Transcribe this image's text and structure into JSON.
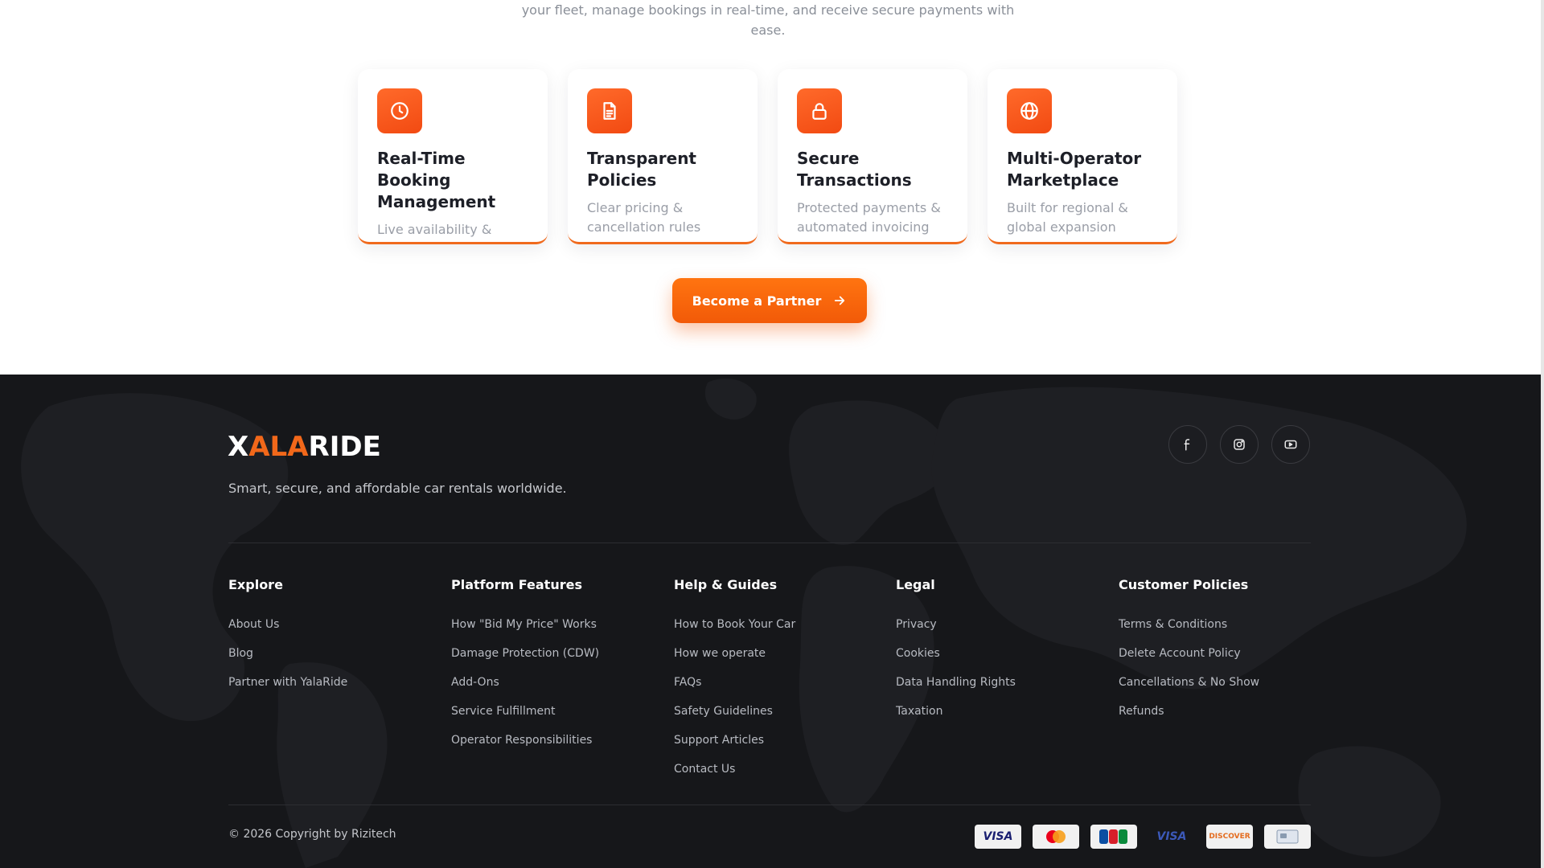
{
  "intro": {
    "line1": "your fleet, manage bookings in real-time, and receive secure payments with",
    "line2": "ease."
  },
  "features": [
    {
      "icon": "clock-icon",
      "title": "Real-Time Booking Management",
      "desc": "Live availability &"
    },
    {
      "icon": "document-icon",
      "title": "Transparent Policies",
      "desc": "Clear pricing & cancellation rules"
    },
    {
      "icon": "lock-icon",
      "title": "Secure Transactions",
      "desc": "Protected payments & automated invoicing"
    },
    {
      "icon": "globe-icon",
      "title": "Multi-Operator Marketplace",
      "desc": "Built for regional & global expansion"
    }
  ],
  "cta": {
    "label": "Become a Partner"
  },
  "footer": {
    "logo": {
      "x": "X",
      "ala": "ALA",
      "ride": "RIDE"
    },
    "tagline": "Smart, secure, and affordable car rentals worldwide.",
    "social": [
      "facebook-icon",
      "instagram-icon",
      "youtube-icon"
    ],
    "columns": [
      {
        "title": "Explore",
        "links": [
          "About Us",
          "Blog",
          "Partner with YalaRide"
        ]
      },
      {
        "title": "Platform Features",
        "links": [
          "How \"Bid My Price\" Works",
          "Damage Protection (CDW)",
          "Add-Ons",
          "Service Fulfillment",
          "Operator Responsibilities"
        ]
      },
      {
        "title": "Help & Guides",
        "links": [
          "How to Book Your Car",
          "How we operate",
          "FAQs",
          "Safety Guidelines",
          "Support Articles",
          "Contact Us"
        ]
      },
      {
        "title": "Legal",
        "links": [
          "Privacy",
          "Cookies",
          "Data Handling Rights",
          "Taxation"
        ]
      },
      {
        "title": "Customer Policies",
        "links": [
          "Terms & Conditions",
          "Delete Account Policy",
          "Cancellations & No Show",
          "Refunds"
        ]
      }
    ],
    "copyright": "© 2026 Copyright by Rizitech",
    "payments": [
      {
        "name": "VISA",
        "color": "#1a1f71"
      },
      {
        "name": "mastercard",
        "color": "#eb001b"
      },
      {
        "name": "jcb",
        "color": "#0b4ea2"
      },
      {
        "name": "VISA",
        "color": "#1a1f71"
      },
      {
        "name": "DISCOVER",
        "color": "#e46c1f"
      },
      {
        "name": "generic-card",
        "color": "#8a9bb0"
      }
    ],
    "accent": "#f2681a"
  }
}
